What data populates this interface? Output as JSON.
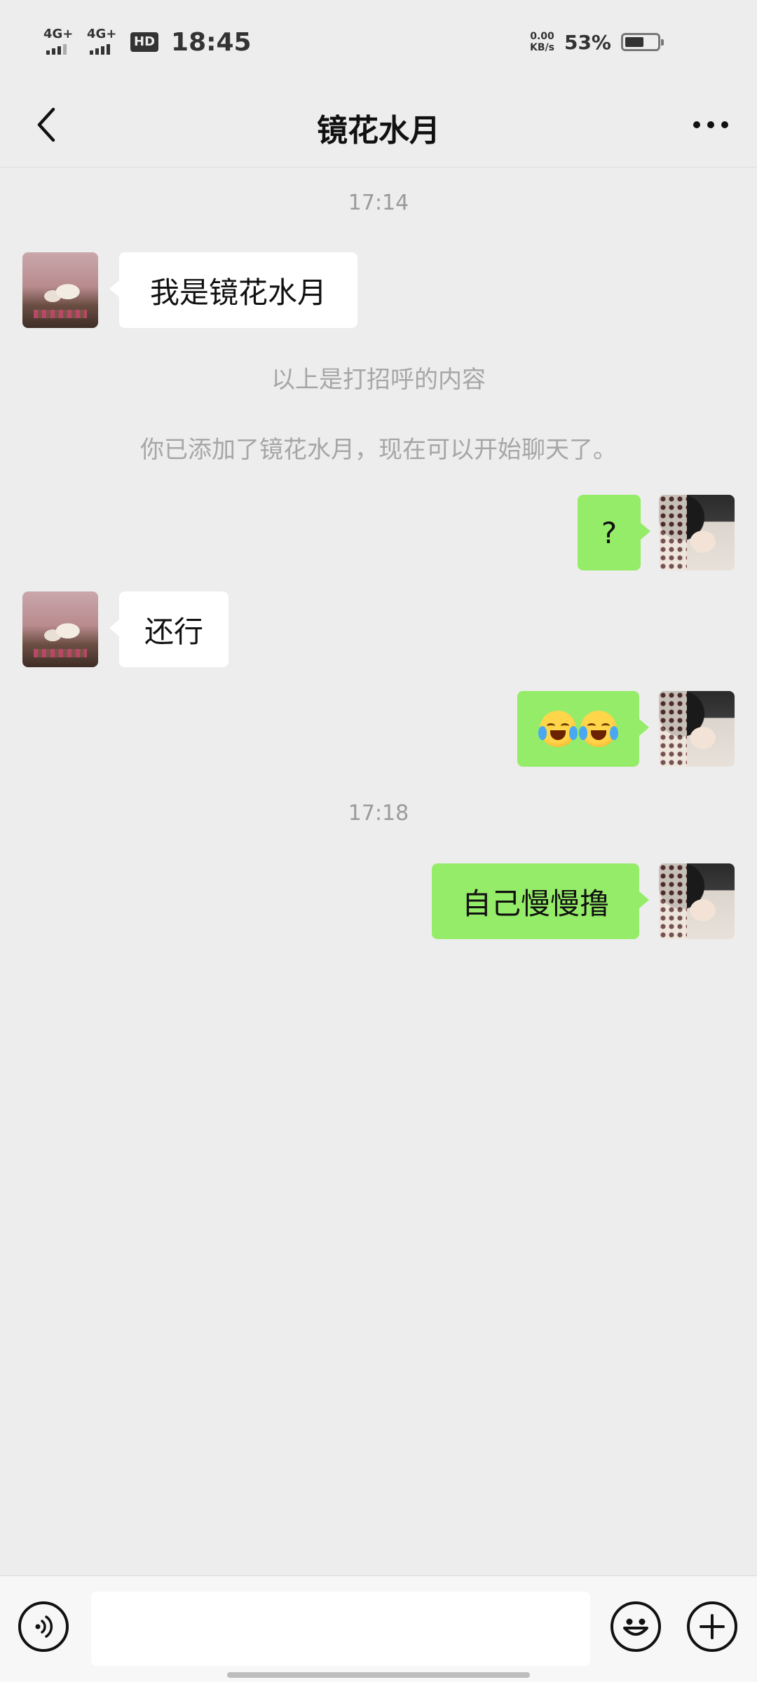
{
  "status_bar": {
    "signal1_label": "4G+",
    "signal2_label": "4G+",
    "hd_label": "HD",
    "time": "18:45",
    "net_speed_value": "0.00",
    "net_speed_unit": "KB/s",
    "battery_percent": "53%"
  },
  "nav": {
    "title": "镜花水月",
    "back_icon": "chevron-left-icon",
    "more_icon": "more-dots-icon"
  },
  "chat": {
    "timestamps": [
      "17:14",
      "17:18"
    ],
    "system_messages": [
      "以上是打招呼的内容",
      "你已添加了镜花水月，现在可以开始聊天了。"
    ],
    "messages": [
      {
        "sender": "other",
        "text": "我是镜花水月"
      },
      {
        "sender": "self",
        "text": "?"
      },
      {
        "sender": "other",
        "text": "还行"
      },
      {
        "sender": "self",
        "text": "",
        "emoji": [
          "face-with-tears-of-joy-icon",
          "face-with-tears-of-joy-icon"
        ]
      },
      {
        "sender": "self",
        "text": "自己慢慢撸"
      }
    ]
  },
  "input_bar": {
    "voice_icon": "voice-icon",
    "emoji_icon": "smiley-icon",
    "plus_icon": "plus-icon",
    "text_value": ""
  },
  "colors": {
    "background": "#EDEDED",
    "bubble_self": "#95EC69",
    "bubble_other": "#FFFFFF"
  }
}
